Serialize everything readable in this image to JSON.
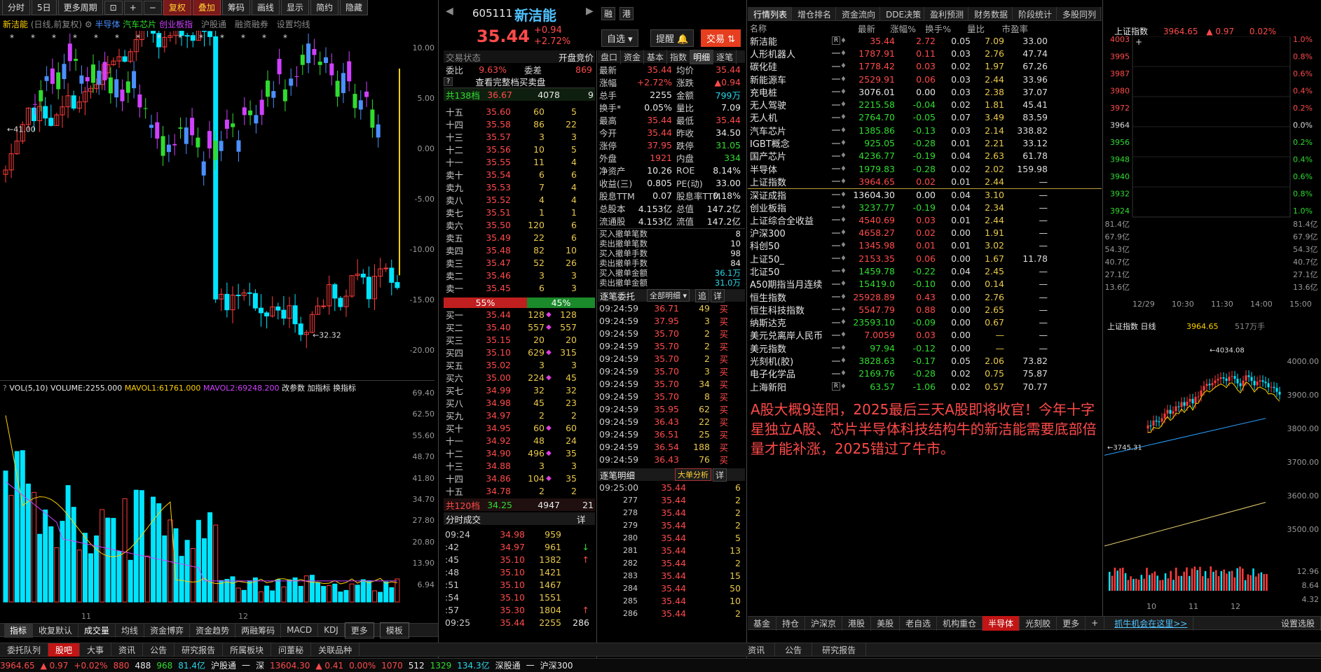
{
  "toolbar": {
    "btns": [
      "分时",
      "5日",
      "更多周期",
      "复权",
      "叠加",
      "筹码",
      "画线",
      "显示",
      "简约",
      "隐藏"
    ]
  },
  "chart": {
    "title": "新洁能",
    "mode": "(日线,前复权)",
    "overlays": [
      "半导体",
      "汽车芯片",
      "创业板指"
    ],
    "links": [
      "沪股通",
      "融资融券",
      "设置均线"
    ],
    "y_ticks": [
      "10.00",
      "5.00",
      "0.00",
      "-5.00",
      "-10.00",
      "-15.00",
      "-20.00"
    ],
    "hi_label": "41.00",
    "lo_label": "32.32",
    "vol_header": "VOL(5,10)",
    "vol_val": "VOLUME:2255.000",
    "ma1": "MAVOL1:61761.000",
    "ma2": "MAVOL2:69248.200",
    "vol_links": [
      "改参数",
      "加指标",
      "换指标"
    ],
    "vol_ticks": [
      "69.40",
      "62.50",
      "55.60",
      "48.70",
      "41.80",
      "34.70",
      "27.80",
      "20.80",
      "13.90",
      "6.94"
    ],
    "months": [
      "11",
      "12"
    ],
    "tabs": [
      "指标",
      "收复默认",
      "成交量",
      "均线",
      "资金博弈",
      "资金趋势",
      "两融筹码",
      "MACD",
      "KDJ",
      "更多",
      "模板"
    ]
  },
  "stock": {
    "code": "605111",
    "name": "新洁能",
    "price": "35.44",
    "chg": "+0.94",
    "pct": "+2.72%",
    "btn_watch": "自选",
    "btn_alert": "提醒",
    "btn_trade": "交易"
  },
  "book": {
    "state_label": "交易状态",
    "state": "开盘竞价",
    "wb_label": "委比",
    "wb": "9.63%",
    "wc_label": "委差",
    "wc": "869",
    "full": "查看完整档买卖盘",
    "sell_total": [
      "共138档",
      "36.67",
      "4078",
      "9"
    ],
    "buy_total": [
      "共120档",
      "34.25",
      "4947",
      "21"
    ],
    "sells": [
      [
        "十五",
        "35.60",
        "60",
        "5"
      ],
      [
        "十四",
        "35.58",
        "86",
        "22"
      ],
      [
        "十三",
        "35.57",
        "3",
        "3"
      ],
      [
        "十二",
        "35.56",
        "10",
        "5"
      ],
      [
        "十一",
        "35.55",
        "11",
        "4"
      ],
      [
        "卖十",
        "35.54",
        "6",
        "6"
      ],
      [
        "卖九",
        "35.53",
        "7",
        "4"
      ],
      [
        "卖八",
        "35.52",
        "4",
        "4"
      ],
      [
        "卖七",
        "35.51",
        "1",
        "1"
      ],
      [
        "卖六",
        "35.50",
        "120",
        "6"
      ],
      [
        "卖五",
        "35.49",
        "22",
        "6"
      ],
      [
        "卖四",
        "35.48",
        "82",
        "10"
      ],
      [
        "卖三",
        "35.47",
        "52",
        "26"
      ],
      [
        "卖二",
        "35.46",
        "3",
        "3"
      ],
      [
        "卖一",
        "35.45",
        "6",
        "3"
      ]
    ],
    "ratio": [
      "55%",
      "45%"
    ],
    "buys": [
      [
        "买一",
        "35.44",
        "128",
        "128"
      ],
      [
        "买二",
        "35.40",
        "557",
        "557"
      ],
      [
        "买三",
        "35.15",
        "20",
        "20"
      ],
      [
        "买四",
        "35.10",
        "629",
        "315"
      ],
      [
        "买五",
        "35.02",
        "3",
        "3"
      ],
      [
        "买六",
        "35.00",
        "224",
        "45"
      ],
      [
        "买七",
        "34.99",
        "32",
        "32"
      ],
      [
        "买八",
        "34.98",
        "45",
        "23"
      ],
      [
        "买九",
        "34.97",
        "2",
        "2"
      ],
      [
        "买十",
        "34.95",
        "60",
        "60"
      ],
      [
        "十一",
        "34.92",
        "48",
        "24"
      ],
      [
        "十二",
        "34.90",
        "496",
        "35"
      ],
      [
        "十三",
        "34.88",
        "3",
        "3"
      ],
      [
        "十四",
        "34.86",
        "104",
        "35"
      ],
      [
        "十五",
        "34.78",
        "2",
        "2"
      ]
    ]
  },
  "ticks": {
    "title": "分时成交",
    "detail": "详",
    "rows": [
      [
        "09:24",
        "34.98",
        "959",
        ""
      ],
      [
        ":42",
        "34.97",
        "961",
        "↓"
      ],
      [
        ":45",
        "35.10",
        "1382",
        "↑"
      ],
      [
        ":48",
        "35.10",
        "1421",
        ""
      ],
      [
        ":51",
        "35.10",
        "1467",
        ""
      ],
      [
        ":54",
        "35.10",
        "1551",
        ""
      ],
      [
        ":57",
        "35.30",
        "1804",
        "↑"
      ],
      [
        "09:25",
        "35.44",
        "2255",
        "286"
      ]
    ]
  },
  "quote": {
    "tabs": [
      "盘口",
      "资金",
      "基本",
      "指数",
      "明细",
      "逐笔"
    ],
    "rows": [
      [
        "最新",
        "35.44",
        "均价",
        "35.44"
      ],
      [
        "涨幅",
        "+2.72%",
        "涨跌",
        "▲0.94"
      ],
      [
        "总手",
        "2255",
        "金额",
        "799万"
      ],
      [
        "换手*",
        "0.05%",
        "量比",
        "7.09"
      ],
      [
        "最高",
        "35.44",
        "最低",
        "35.44"
      ],
      [
        "今开",
        "35.44",
        "昨收",
        "34.50"
      ],
      [
        "涨停",
        "37.95",
        "跌停",
        "31.05"
      ],
      [
        "外盘",
        "1921",
        "内盘",
        "334"
      ],
      [
        "净资产",
        "10.26",
        "ROE",
        "8.14%"
      ],
      [
        "收益(三)",
        "0.805",
        "PE(动)",
        "33.00"
      ],
      [
        "股息TTM",
        "0.07",
        "股息率TTM",
        "0.18%"
      ],
      [
        "总股本",
        "4.153亿",
        "总值",
        "147.2亿"
      ],
      [
        "流通股",
        "4.153亿",
        "流值",
        "147.2亿"
      ]
    ],
    "cancel": [
      [
        "买入撤单笔数",
        "8"
      ],
      [
        "卖出撤单笔数",
        "10"
      ],
      [
        "买入撤单手数",
        "98"
      ],
      [
        "卖出撤单手数",
        "84"
      ],
      [
        "买入撤单金额",
        "36.1万"
      ],
      [
        "卖出撤单金额",
        "31.0万"
      ]
    ]
  },
  "orders": {
    "title": "逐笔委托",
    "filter": "全部明细",
    "add": "追",
    "detail": "详",
    "rows": [
      [
        "09:24:59",
        "36.71",
        "49",
        "买"
      ],
      [
        "09:24:59",
        "37.95",
        "3",
        "买"
      ],
      [
        "09:24:59",
        "35.70",
        "2",
        "买"
      ],
      [
        "09:24:59",
        "35.70",
        "2",
        "买"
      ],
      [
        "09:24:59",
        "35.70",
        "2",
        "买"
      ],
      [
        "09:24:59",
        "35.70",
        "3",
        "买"
      ],
      [
        "09:24:59",
        "35.70",
        "34",
        "买"
      ],
      [
        "09:24:59",
        "35.70",
        "8",
        "买"
      ],
      [
        "09:24:59",
        "35.95",
        "62",
        "买"
      ],
      [
        "09:24:59",
        "36.43",
        "22",
        "买"
      ],
      [
        "09:24:59",
        "36.51",
        "25",
        "买"
      ],
      [
        "09:24:59",
        "36.54",
        "188",
        "买"
      ],
      [
        "09:24:59",
        "36.43",
        "76",
        "买"
      ]
    ]
  },
  "deals": {
    "title": "逐笔明细",
    "big": "大单分析",
    "detail": "详",
    "rows": [
      [
        "09:25:00",
        "35.44",
        "6"
      ],
      [
        "277",
        "35.44",
        "2"
      ],
      [
        "278",
        "35.44",
        "2"
      ],
      [
        "279",
        "35.44",
        "2"
      ],
      [
        "280",
        "35.44",
        "5"
      ],
      [
        "281",
        "35.44",
        "13"
      ],
      [
        "282",
        "35.44",
        "2"
      ],
      [
        "283",
        "35.44",
        "15"
      ],
      [
        "284",
        "35.44",
        "50"
      ],
      [
        "285",
        "35.44",
        "10"
      ],
      [
        "286",
        "35.44",
        "2"
      ]
    ]
  },
  "market": {
    "tabs": [
      "行情列表",
      "增仓排名",
      "资金流向",
      "DDE决策",
      "盈利预测",
      "财务数据",
      "阶段统计",
      "多股同列"
    ],
    "cols": [
      "名称",
      "最新",
      "涨幅%",
      "换手%",
      "量比",
      "市盈率"
    ],
    "rows": [
      [
        "新洁能",
        "R",
        "35.44",
        "2.72",
        "0.05",
        "7.09",
        "33.00"
      ],
      [
        "人形机器人",
        "",
        "1787.91",
        "0.11",
        "0.03",
        "2.76",
        "47.74"
      ],
      [
        "碳化硅",
        "",
        "1778.42",
        "0.03",
        "0.02",
        "1.97",
        "67.26"
      ],
      [
        "新能源车",
        "",
        "2529.91",
        "0.06",
        "0.03",
        "2.44",
        "33.96"
      ],
      [
        "充电桩",
        "",
        "3076.01",
        "0.00",
        "0.03",
        "2.38",
        "37.07"
      ],
      [
        "无人驾驶",
        "",
        "2215.58",
        "-0.04",
        "0.02",
        "1.81",
        "45.41"
      ],
      [
        "无人机",
        "",
        "2764.70",
        "-0.05",
        "0.07",
        "3.49",
        "83.59"
      ],
      [
        "汽车芯片",
        "",
        "1385.86",
        "-0.13",
        "0.03",
        "2.14",
        "338.82"
      ],
      [
        "IGBT概念",
        "",
        "925.05",
        "-0.28",
        "0.01",
        "2.21",
        "33.12"
      ],
      [
        "国产芯片",
        "",
        "4236.77",
        "-0.19",
        "0.04",
        "2.63",
        "61.78"
      ],
      [
        "半导体",
        "",
        "1979.83",
        "-0.28",
        "0.02",
        "2.02",
        "159.98"
      ],
      [
        "上证指数",
        "",
        "3964.65",
        "0.02",
        "0.01",
        "2.44",
        "—"
      ],
      [
        "深证成指",
        "",
        "13604.30",
        "0.00",
        "0.04",
        "3.10",
        "—"
      ],
      [
        "创业板指",
        "",
        "3237.77",
        "-0.19",
        "0.04",
        "2.34",
        "—"
      ],
      [
        "上证综合全收益",
        "",
        "4540.69",
        "0.03",
        "0.01",
        "2.44",
        "—"
      ],
      [
        "沪深300",
        "",
        "4658.27",
        "0.02",
        "0.00",
        "1.91",
        "—"
      ],
      [
        "科创50",
        "",
        "1345.98",
        "0.01",
        "0.01",
        "3.02",
        "—"
      ],
      [
        "上证50_",
        "",
        "2153.35",
        "0.06",
        "0.00",
        "1.67",
        "11.78"
      ],
      [
        "北证50",
        "",
        "1459.78",
        "-0.22",
        "0.04",
        "2.45",
        "—"
      ],
      [
        "A50期指当月连续",
        "",
        "15419.0",
        "-0.10",
        "0.00",
        "0.14",
        "—"
      ],
      [
        "恒生指数",
        "",
        "25928.89",
        "0.43",
        "0.00",
        "2.76",
        "—"
      ],
      [
        "恒生科技指数",
        "",
        "5547.79",
        "0.88",
        "0.00",
        "2.65",
        "—"
      ],
      [
        "纳斯达克",
        "",
        "23593.10",
        "-0.09",
        "0.00",
        "0.67",
        "—"
      ],
      [
        "美元兑离岸人民币",
        "",
        "7.0059",
        "0.03",
        "0.00",
        "—",
        "—"
      ],
      [
        "美元指数",
        "",
        "97.94",
        "-0.12",
        "0.00",
        "—",
        "—"
      ],
      [
        "光刻机(胶)",
        "",
        "3828.63",
        "-0.17",
        "0.05",
        "2.06",
        "73.82"
      ],
      [
        "电子化学品",
        "",
        "2169.76",
        "-0.28",
        "0.02",
        "0.75",
        "75.87"
      ],
      [
        "上海新阳",
        "R",
        "63.57",
        "-1.06",
        "0.02",
        "0.57",
        "70.77"
      ]
    ],
    "news": "A股大概9连阳，2025最后三天A股即将收官！今年十字星独立A股、芯片半导体科技结构牛的新洁能需要底部倍量才能补涨，2025错过了牛市。",
    "bottom_tabs": [
      "基金",
      "持仓",
      "沪深京",
      "港股",
      "美股",
      "老自选",
      "机构重仓",
      "半导体",
      "光刻胶",
      "更多"
    ],
    "link": "抓牛机会在这里>>",
    "settings": "设置选股"
  },
  "index": {
    "name": "上证指数",
    "val": "3964.65",
    "chg": "▲ 0.97",
    "pct": "0.02%",
    "ly": [
      "4003",
      "3995",
      "3987",
      "3980",
      "3972",
      "3964",
      "3956",
      "3948",
      "3940",
      "3932",
      "3924"
    ],
    "ry": [
      "1.0%",
      "0.8%",
      "0.6%",
      "0.4%",
      "0.2%",
      "0.0%",
      "0.2%",
      "0.4%",
      "0.6%",
      "0.8%",
      "1.0%"
    ],
    "vy": [
      "81.4亿",
      "67.9亿",
      "54.3亿",
      "40.7亿",
      "27.1亿",
      "13.6亿"
    ],
    "times": [
      "12/29",
      "10:30",
      "11:30",
      "14:00",
      "15:00"
    ],
    "k_title": "上证指数 日线",
    "k_val": "3964.65",
    "k_vol": "517万手",
    "k_ticks": [
      "4000.00",
      "3900.00",
      "3800.00",
      "3700.00",
      "3600.00",
      "3500.00"
    ],
    "k_hi": "4034.08",
    "k_lo": "3745.31",
    "kv_ticks": [
      "12.96",
      "8.64",
      "4.32"
    ],
    "k_months": [
      "10",
      "11",
      "12"
    ]
  },
  "bottom": {
    "tabs": [
      "委托队列",
      "股吧",
      "大事",
      "资讯",
      "公告",
      "研究报告",
      "所属板块",
      "问董秘",
      "关联品种"
    ],
    "tabs2": [
      "资讯",
      "公告",
      "研究报告"
    ],
    "status": [
      [
        "3964.65",
        "▲ 0.97",
        "+0.02%",
        "880",
        "488",
        "968",
        "81.4亿"
      ],
      [
        "沪股通",
        "一"
      ],
      [
        "深",
        "13604.30",
        "▲ 0.41",
        "0.00%",
        "1070",
        "512",
        "1329",
        "134.3亿"
      ],
      [
        "深股通",
        "一"
      ],
      [
        "沪深300"
      ]
    ]
  }
}
